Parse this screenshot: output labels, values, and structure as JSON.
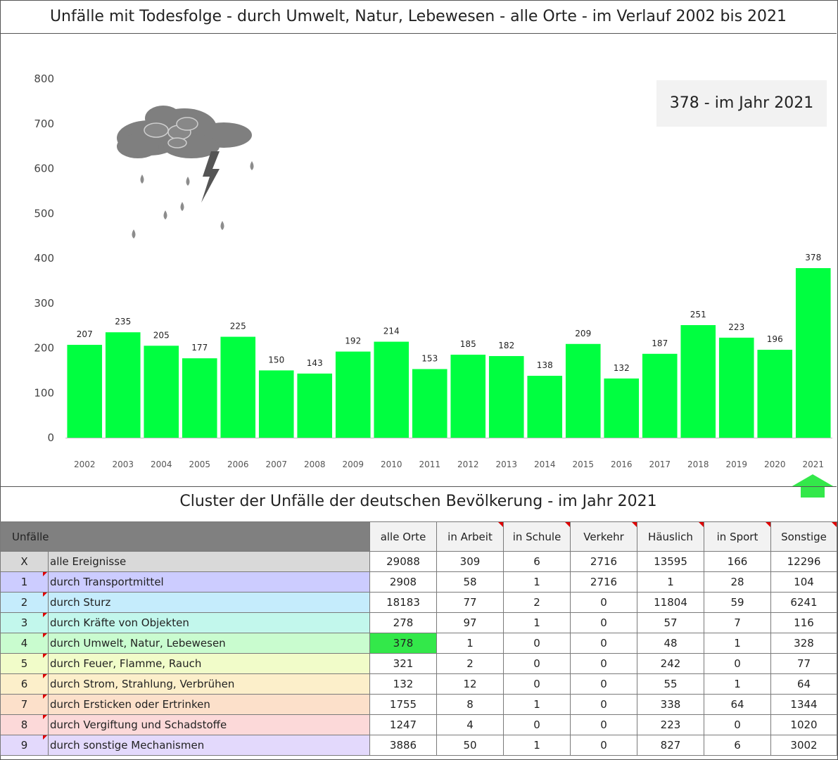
{
  "chart_title": "Unfälle mit Todesfolge - durch Umwelt, Natur, Lebewesen - alle Orte - im Verlauf 2002 bis 2021",
  "highlight": "378 - im Jahr 2021",
  "chart_data": {
    "type": "bar",
    "title": "Unfälle mit Todesfolge - durch Umwelt, Natur, Lebewesen - alle Orte - im Verlauf 2002 bis 2021",
    "categories": [
      "2002",
      "2003",
      "2004",
      "2005",
      "2006",
      "2007",
      "2008",
      "2009",
      "2010",
      "2011",
      "2012",
      "2013",
      "2014",
      "2015",
      "2016",
      "2017",
      "2018",
      "2019",
      "2020",
      "2021"
    ],
    "values": [
      207,
      235,
      205,
      177,
      225,
      150,
      143,
      192,
      214,
      153,
      185,
      182,
      138,
      209,
      132,
      187,
      251,
      223,
      196,
      378
    ],
    "ylim": [
      0,
      800
    ],
    "yticks": [
      0,
      100,
      200,
      300,
      400,
      500,
      600,
      700,
      800
    ],
    "bar_color": "#00ff40",
    "data_labels": true,
    "grid": false
  },
  "table": {
    "title": "Cluster der Unfälle der deutschen Bevölkerung - im Jahr 2021",
    "header_label": "Unfälle",
    "columns": [
      "alle Orte",
      "in Arbeit",
      "in Schule",
      "Verkehr",
      "Häuslich",
      "in Sport",
      "Sonstige"
    ],
    "rows": [
      {
        "idx": "X",
        "label": "alle Ereignisse",
        "values": [
          "29088",
          "309",
          "6",
          "2716",
          "13595",
          "166",
          "12296"
        ],
        "color": "#d9d9d9"
      },
      {
        "idx": "1",
        "label": "durch Transportmittel",
        "values": [
          "2908",
          "58",
          "1",
          "2716",
          "1",
          "28",
          "104"
        ],
        "color": "#ccccff"
      },
      {
        "idx": "2",
        "label": "durch Sturz",
        "values": [
          "18183",
          "77",
          "2",
          "0",
          "11804",
          "59",
          "6241"
        ],
        "color": "#c5ecfc"
      },
      {
        "idx": "3",
        "label": "durch Kräfte von Objekten",
        "values": [
          "278",
          "97",
          "1",
          "0",
          "57",
          "7",
          "116"
        ],
        "color": "#c2f7ec"
      },
      {
        "idx": "4",
        "label": "durch Umwelt, Natur, Lebewesen",
        "values": [
          "378",
          "1",
          "0",
          "0",
          "48",
          "1",
          "328"
        ],
        "color": "#c9fccf"
      },
      {
        "idx": "5",
        "label": "durch Feuer, Flamme, Rauch",
        "values": [
          "321",
          "2",
          "0",
          "0",
          "242",
          "0",
          "77"
        ],
        "color": "#f1fcc9"
      },
      {
        "idx": "6",
        "label": "durch Strom, Strahlung, Verbrühen",
        "values": [
          "132",
          "12",
          "0",
          "0",
          "55",
          "1",
          "64"
        ],
        "color": "#fcefca"
      },
      {
        "idx": "7",
        "label": "durch Ersticken oder Ertrinken",
        "values": [
          "1755",
          "8",
          "1",
          "0",
          "338",
          "64",
          "1344"
        ],
        "color": "#fce0ca"
      },
      {
        "idx": "8",
        "label": "durch Vergiftung und Schadstoffe",
        "values": [
          "1247",
          "4",
          "0",
          "0",
          "223",
          "0",
          "1020"
        ],
        "color": "#fcd9d9"
      },
      {
        "idx": "9",
        "label": "durch sonstige Mechanismen",
        "values": [
          "3886",
          "50",
          "1",
          "0",
          "827",
          "6",
          "3002"
        ],
        "color": "#e3d9fc"
      }
    ],
    "highlight_cell_color": "#33e84a"
  }
}
